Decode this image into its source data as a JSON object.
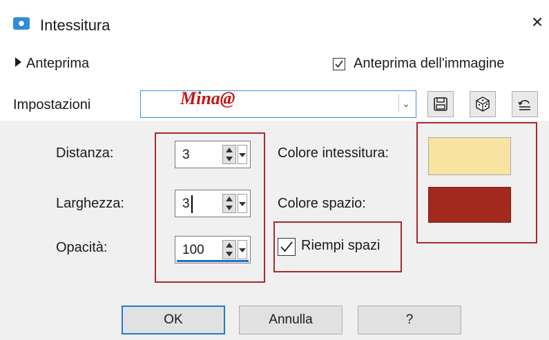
{
  "window": {
    "title": "Intessitura",
    "icon": "camera-icon",
    "close_glyph": "×"
  },
  "preview": {
    "expander_label": "Anteprima",
    "image_preview_label": "Anteprima dell'immagine",
    "image_preview_checked": true
  },
  "settings": {
    "label": "Impostazioni",
    "value": "Mina@",
    "toolbar": {
      "save_icon": "save-icon",
      "random_icon": "dice-icon",
      "reset_icon": "reset-icon"
    }
  },
  "fields": {
    "distance": {
      "label": "Distanza:",
      "value": "3"
    },
    "width": {
      "label": "Larghezza:",
      "value": "3"
    },
    "opacity": {
      "label": "Opacità:",
      "value": "100"
    }
  },
  "colors": {
    "weave": {
      "label": "Colore intessitura:",
      "value": "#f8e3a3"
    },
    "gap": {
      "label": "Colore spazio:",
      "value": "#a3291e"
    }
  },
  "fill_gaps": {
    "label": "Riempi spazi",
    "checked": true
  },
  "buttons": {
    "ok": "OK",
    "cancel": "Annulla",
    "help": "?"
  },
  "theme": {
    "accent": "#1f7ad3",
    "annotation": "#a8282a",
    "panel_bg": "#f0f0f0"
  }
}
